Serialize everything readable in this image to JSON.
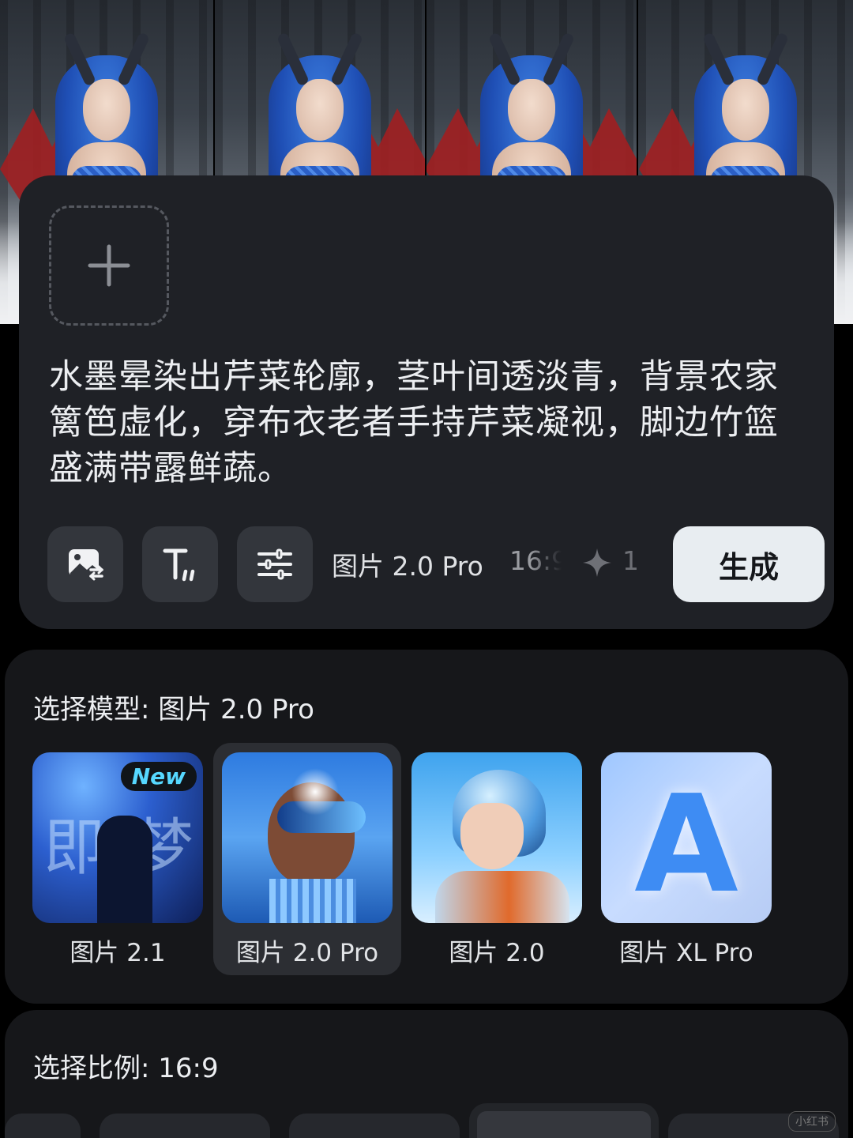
{
  "prompt": {
    "text": "水墨晕染出芹菜轮廓，茎叶间透淡青，背景农家篱笆虚化，穿布衣老者手持芹菜凝视，脚边竹篮盛满带露鲜蔬。",
    "model_label": "图片 2.0 Pro",
    "ratio_label": "16:9",
    "credit_count": "1",
    "generate_label": "生成"
  },
  "model_panel": {
    "title": "选择模型: 图片 2.0 Pro",
    "models": [
      {
        "name": "图片 2.1",
        "badge": "New",
        "thumb_text": [
          "即",
          "梦"
        ]
      },
      {
        "name": "图片 2.0 Pro",
        "selected": true
      },
      {
        "name": "图片 2.0"
      },
      {
        "name": "图片 XL Pro",
        "thumb_text": [
          "A"
        ]
      }
    ]
  },
  "ratio_panel": {
    "title": "选择比例: 16:9"
  },
  "watermark": "小红书",
  "colors": {
    "card_bg": "#1f2126",
    "panel_bg": "#16171a",
    "tool_btn_bg": "#33363c",
    "generate_bg": "#e8edf1",
    "new_badge_text": "#56d8ff",
    "selected_card_bg": "#2c2e33"
  },
  "icons": [
    "plus-icon",
    "image-reference-icon",
    "text-style-icon",
    "sliders-icon",
    "sparkle-icon"
  ]
}
